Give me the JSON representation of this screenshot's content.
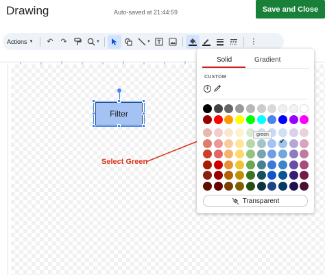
{
  "header": {
    "title": "Drawing",
    "autosave": "Auto-saved at 21:44:59",
    "save_label": "Save and Close"
  },
  "toolbar": {
    "actions_label": "Actions",
    "icons": [
      "undo-icon",
      "redo-icon",
      "paint-format-icon",
      "zoom-icon",
      "select-icon",
      "shape-icon",
      "line-icon",
      "textbox-icon",
      "image-icon",
      "fill-color-icon",
      "border-color-icon",
      "border-weight-icon",
      "border-dash-icon",
      "more-icon"
    ]
  },
  "canvas": {
    "shape_text": "Filter",
    "annotation": "Select Green",
    "annotation_color": "#d9361e"
  },
  "palette": {
    "tabs": [
      "Solid",
      "Gradient"
    ],
    "active_tab": "Solid",
    "custom_label": "CUSTOM",
    "tooltip": "green",
    "transparent_label": "Transparent",
    "selected_color": "green",
    "rows": [
      [
        "#000000",
        "#434343",
        "#666666",
        "#999999",
        "#b7b7b7",
        "#cccccc",
        "#d9d9d9",
        "#efefef",
        "#f3f3f3",
        "#ffffff"
      ],
      [
        "#980000",
        "#ff0000",
        "#ff9900",
        "#ffff00",
        "#00ff00",
        "#00ffff",
        "#4a86e8",
        "#0000ff",
        "#9900ff",
        "#ff00ff"
      ],
      [
        "#e6b8af",
        "#f4cccc",
        "#fce5cd",
        "#fff2cc",
        "#d9ead3",
        "#d0e0e3",
        "#c9daf8",
        "#cfe2f3",
        "#d9d2e9",
        "#ead1dc"
      ],
      [
        "#dd7e6b",
        "#ea9999",
        "#f9cb9c",
        "#ffe599",
        "#b6d7a8",
        "#a2c4c9",
        "#a4c2f4",
        "#9fc5e8",
        "#b4a7d6",
        "#d5a6bd"
      ],
      [
        "#cc4125",
        "#e06666",
        "#f6b26b",
        "#ffd966",
        "#93c47d",
        "#76a5af",
        "#6d9eeb",
        "#6fa8dc",
        "#8e7cc3",
        "#c27ba0"
      ],
      [
        "#a61c00",
        "#cc0000",
        "#e69138",
        "#f1c232",
        "#6aa84f",
        "#45818e",
        "#3c78d8",
        "#3d85c6",
        "#674ea7",
        "#a64d79"
      ],
      [
        "#85200c",
        "#990000",
        "#b45f06",
        "#bf9000",
        "#38761d",
        "#134f5c",
        "#1155cc",
        "#0b5394",
        "#351c75",
        "#741b47"
      ],
      [
        "#5b0f00",
        "#660000",
        "#783f04",
        "#7f6000",
        "#274e13",
        "#0c343d",
        "#1c4587",
        "#073763",
        "#20124d",
        "#4c1130"
      ]
    ]
  }
}
